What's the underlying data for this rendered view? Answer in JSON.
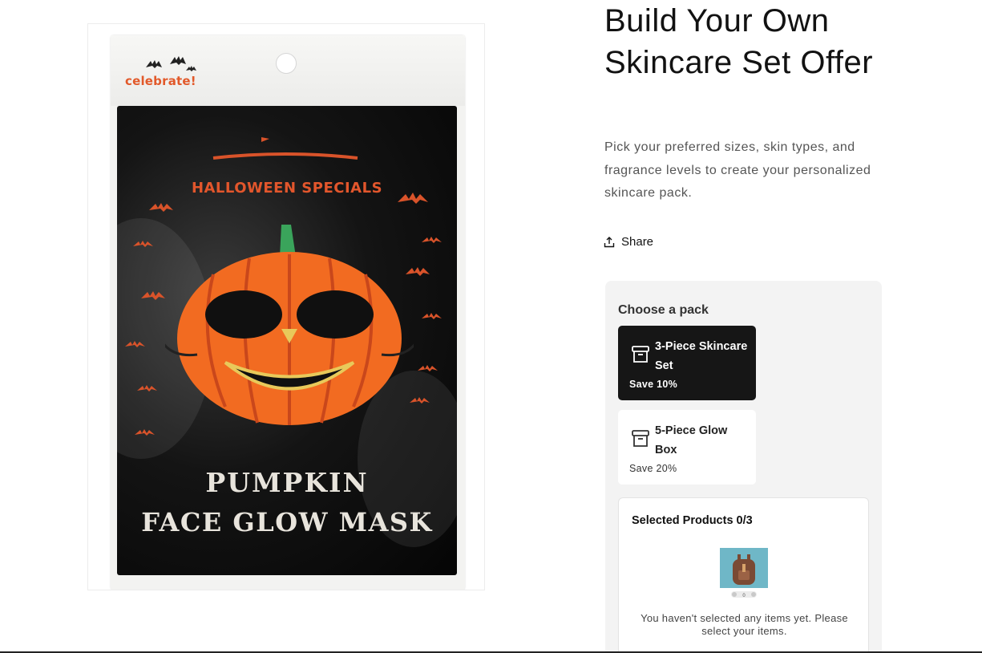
{
  "product": {
    "title": "Build Your Own Skincare Set Offer",
    "description": "Pick your preferred sizes, skin types, and fragrance levels to create your personalized skincare pack.",
    "share_label": "Share"
  },
  "image": {
    "brand_text": "celebrate!",
    "banner_text": "HALLOWEEN SPECIALS",
    "name_line1": "PUMPKIN",
    "name_line2": "FACE GLOW MASK"
  },
  "bundle": {
    "choose_label": "Choose a pack",
    "packs": [
      {
        "name": "3-Piece Skincare Set",
        "save": "Save 10%",
        "selected": true
      },
      {
        "name": "5-Piece Glow Box",
        "save": "Save 20%",
        "selected": false
      }
    ],
    "selected_title": "Selected Products 0/3",
    "empty_message": "You haven't selected any items yet. Please select your items.",
    "illustration_count": "0"
  },
  "colors": {
    "accent_orange": "#e2562c",
    "selected_card_bg": "#161616",
    "widget_bg": "#f3f3f3"
  }
}
